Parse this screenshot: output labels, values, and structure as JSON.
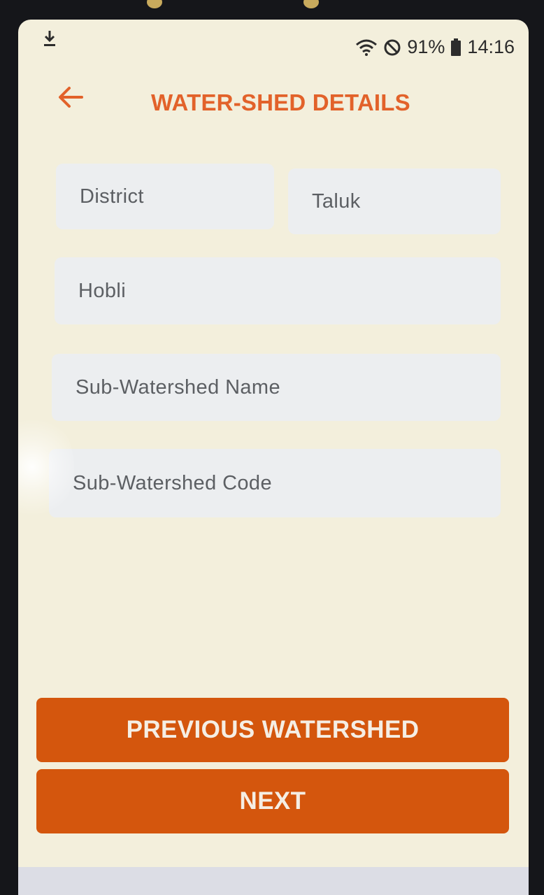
{
  "status_bar": {
    "battery": "91%",
    "time": "14:16",
    "icons": [
      "download-icon",
      "wifi-icon",
      "do-not-disturb-icon",
      "battery-icon"
    ]
  },
  "header": {
    "back_icon": "arrow-left-icon",
    "title": "WATER-SHED DETAILS"
  },
  "form": {
    "district_placeholder": "District",
    "taluk_placeholder": "Taluk",
    "hobli_placeholder": "Hobli",
    "sub_watershed_name_placeholder": "Sub-Watershed Name",
    "sub_watershed_code_placeholder": "Sub-Watershed Code"
  },
  "actions": {
    "previous_label": "PREVIOUS WATERSHED",
    "next_label": "NEXT"
  },
  "colors": {
    "accent": "#e2622a",
    "button": "#d4560d",
    "background": "#f3efdc",
    "field": "#eceef0"
  }
}
